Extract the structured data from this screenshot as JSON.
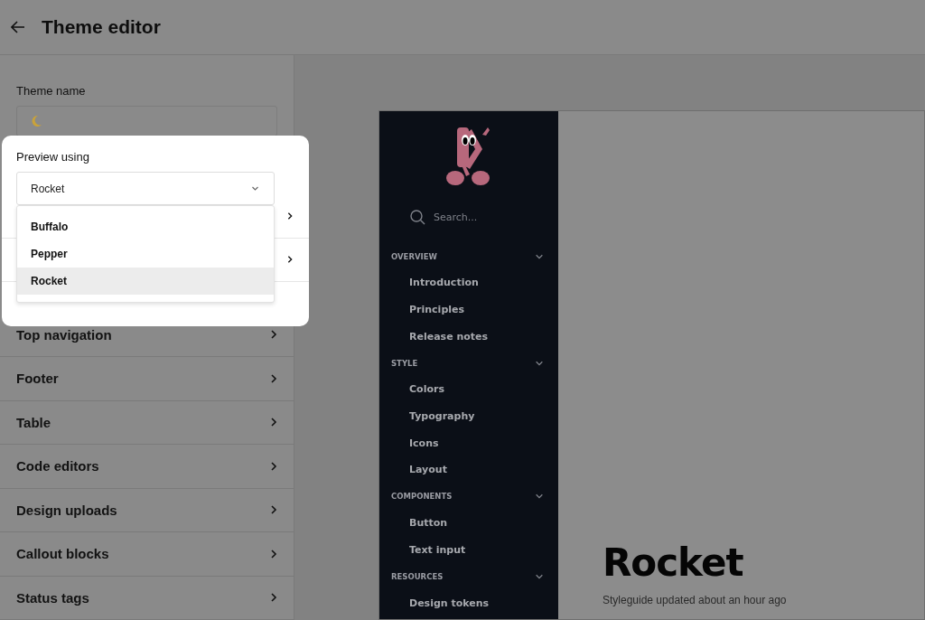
{
  "header": {
    "title": "Theme editor"
  },
  "theme_name": {
    "label": "Theme name"
  },
  "preview_using": {
    "label": "Preview using",
    "value": "Rocket",
    "options": [
      {
        "label": "Buffalo",
        "selected": false
      },
      {
        "label": "Pepper",
        "selected": false
      },
      {
        "label": "Rocket",
        "selected": true
      }
    ]
  },
  "sections": [
    {
      "label": "Top navigation"
    },
    {
      "label": "Footer"
    },
    {
      "label": "Table"
    },
    {
      "label": "Code editors"
    },
    {
      "label": "Design uploads"
    },
    {
      "label": "Callout blocks"
    },
    {
      "label": "Status tags"
    }
  ],
  "preview": {
    "search_placeholder": "Search...",
    "nav": [
      {
        "heading": "OVERVIEW",
        "expanded": true,
        "items": [
          "Introduction",
          "Principles",
          "Release notes"
        ]
      },
      {
        "heading": "STYLE",
        "expanded": true,
        "items": [
          "Colors",
          "Typography",
          "Icons",
          "Layout"
        ]
      },
      {
        "heading": "COMPONENTS",
        "expanded": true,
        "items": [
          "Button",
          "Text input"
        ]
      },
      {
        "heading": "RESOURCES",
        "expanded": true,
        "items": [
          "Design tokens"
        ]
      }
    ],
    "title": "Rocket",
    "subtitle": "Styleguide updated about an hour ago"
  }
}
